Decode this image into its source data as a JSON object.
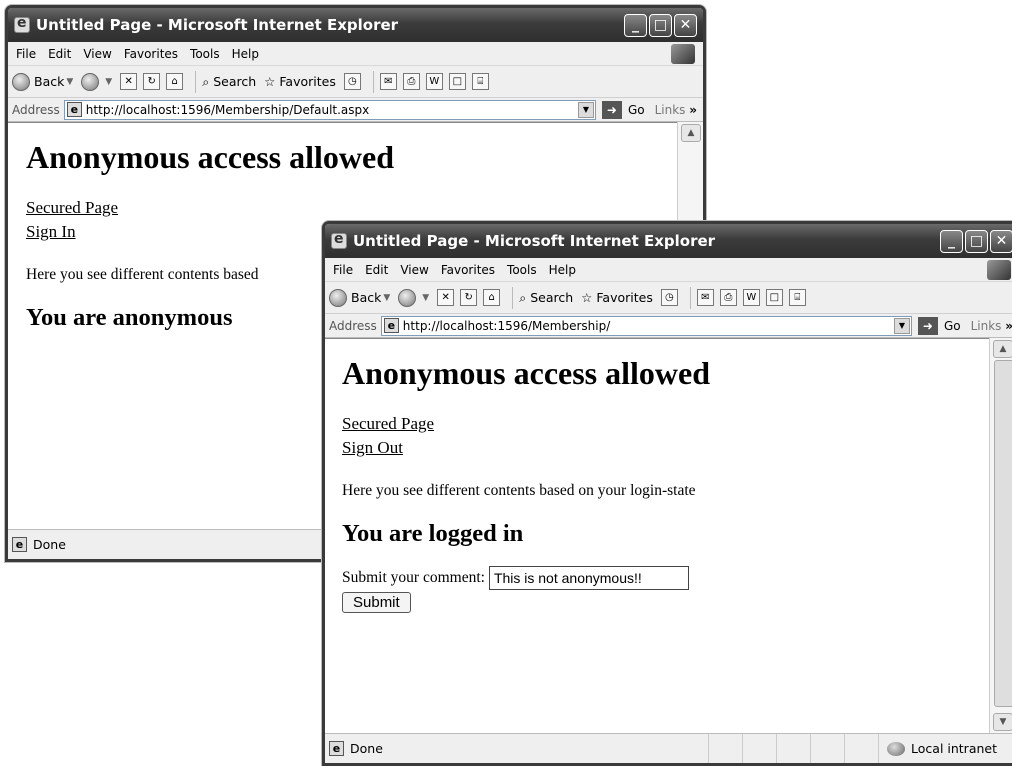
{
  "window1": {
    "title": "Untitled Page - Microsoft Internet Explorer",
    "menu": [
      "File",
      "Edit",
      "View",
      "Favorites",
      "Tools",
      "Help"
    ],
    "toolbar": {
      "back": "Back",
      "search": "Search",
      "favorites": "Favorites"
    },
    "address_label": "Address",
    "url": "http://localhost:1596/Membership/Default.aspx",
    "go": "Go",
    "links": "Links",
    "links_chevron": "»",
    "page": {
      "heading": "Anonymous access allowed",
      "link1": "Secured Page",
      "link2": "Sign In",
      "paragraph": "Here you see different contents based",
      "status_heading": "You are anonymous"
    },
    "status": "Done"
  },
  "window2": {
    "title": "Untitled Page - Microsoft Internet Explorer",
    "menu": [
      "File",
      "Edit",
      "View",
      "Favorites",
      "Tools",
      "Help"
    ],
    "toolbar": {
      "back": "Back",
      "search": "Search",
      "favorites": "Favorites"
    },
    "address_label": "Address",
    "url": "http://localhost:1596/Membership/",
    "go": "Go",
    "links": "Links",
    "links_chevron": "»",
    "page": {
      "heading": "Anonymous access allowed",
      "link1": "Secured Page",
      "link2": "Sign Out",
      "paragraph": "Here you see different contents based on your login-state",
      "status_heading": "You are logged in",
      "comment_label": "Submit your comment:",
      "comment_value": "This is not anonymous!!",
      "submit_label": "Submit"
    },
    "status": "Done",
    "zone": "Local intranet"
  },
  "icons": {
    "caption": [
      "minimize-icon",
      "maximize-icon",
      "close-icon"
    ]
  }
}
